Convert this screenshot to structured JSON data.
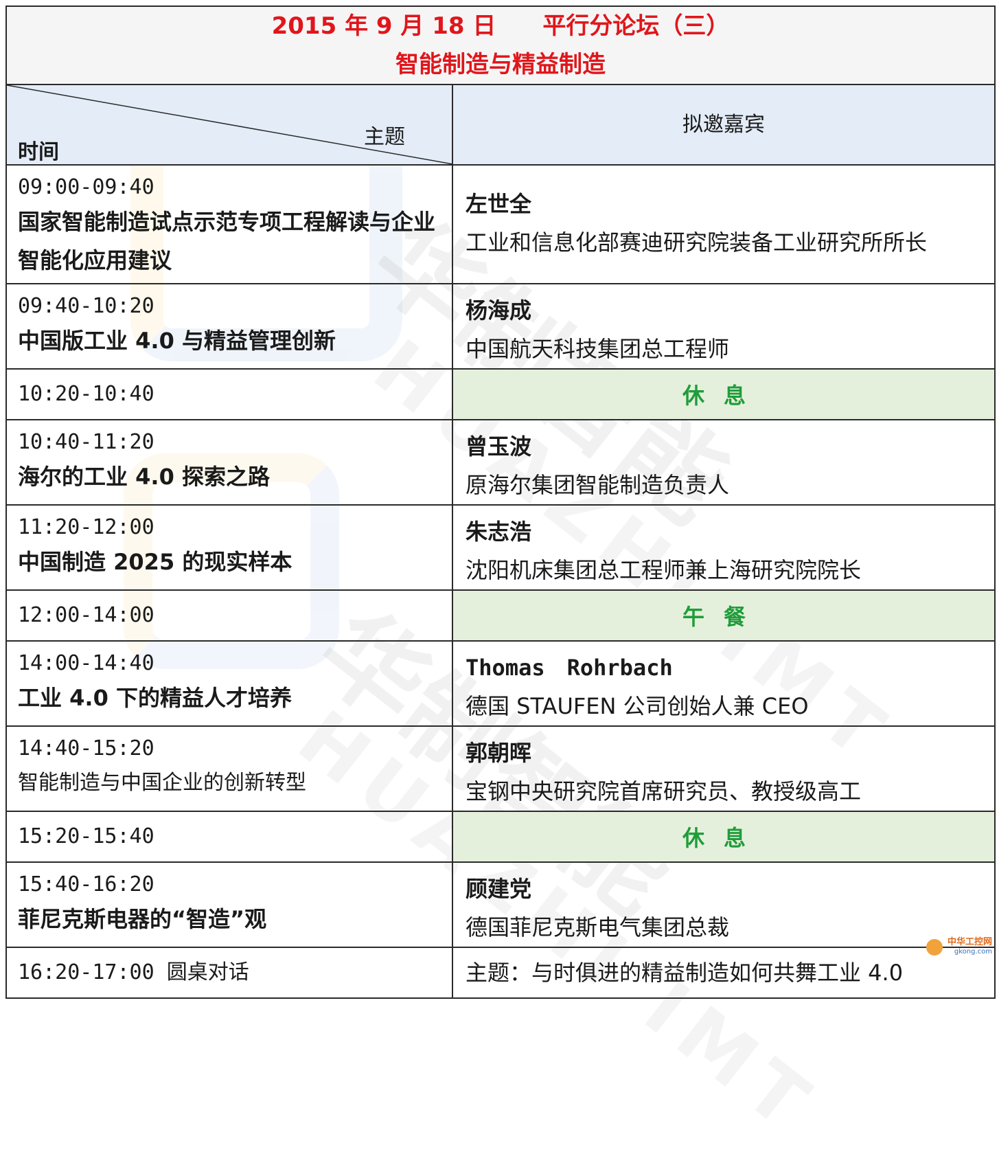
{
  "header": {
    "title_line1": "2015 年 9 月 18 日　　平行分论坛（三）",
    "title_line2": "智能制造与精益制造",
    "col_topic_label": "主题",
    "col_time_label": "时间",
    "col_guest_label": "拟邀嘉宾"
  },
  "rows": [
    {
      "time": "09:00-09:40",
      "topic": "国家智能制造试点示范专项工程解读与企业智能化应用建议",
      "name": "左世全",
      "role": "工业和信息化部赛迪研究院装备工业研究所所长"
    },
    {
      "time": "09:40-10:20",
      "topic": "中国版工业 4.0 与精益管理创新",
      "name": "杨海成",
      "role": "中国航天科技集团总工程师"
    },
    {
      "time": "10:20-10:40",
      "break": "休息"
    },
    {
      "time": "10:40-11:20",
      "topic": "海尔的工业 4.0 探索之路",
      "name": "曾玉波",
      "role": "原海尔集团智能制造负责人"
    },
    {
      "time": "11:20-12:00",
      "topic": "中国制造 2025 的现实样本",
      "name": "朱志浩",
      "role": "沈阳机床集团总工程师兼上海研究院院长"
    },
    {
      "time": "12:00-14:00",
      "break": "午餐"
    },
    {
      "time": "14:00-14:40",
      "topic": "工业 4.0 下的精益人才培养",
      "name": "Thomas　Rohrbach",
      "role": "德国 STAUFEN 公司创始人兼 CEO"
    },
    {
      "time": "14:40-15:20",
      "topic": "智能制造与中国企业的创新转型",
      "name": "郭朝晖",
      "role": "宝钢中央研究院首席研究员、教授级高工"
    },
    {
      "time": "15:20-15:40",
      "break": "休息"
    },
    {
      "time": "15:40-16:20",
      "topic": "菲尼克斯电器的“智造”观",
      "name": "顾建党",
      "role": "德国菲尼克斯电气集团总裁"
    },
    {
      "time": "16:20-17:00 圆桌对话",
      "role": "主题：与时俱进的精益制造如何共舞工业 4.0"
    }
  ],
  "watermark": {
    "cn": "华制智能",
    "en": "HUAZHI IMT"
  },
  "corner_logo": {
    "name": "中华工控网",
    "url_text": "gkong.com"
  }
}
